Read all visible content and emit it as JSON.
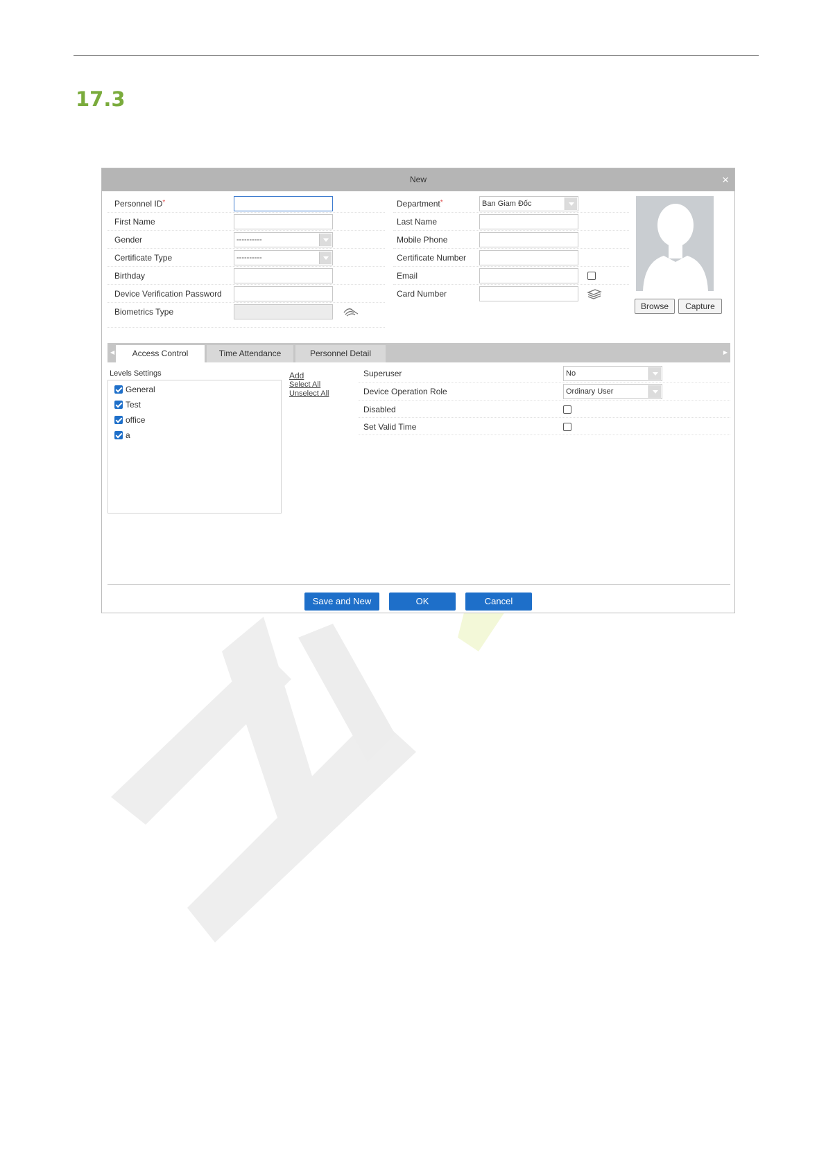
{
  "section": {
    "number": "17.3"
  },
  "dialog": {
    "title": "New",
    "close": "×",
    "fields": {
      "personnel_id": {
        "label": "Personnel ID",
        "required": "*",
        "value": ""
      },
      "first_name": {
        "label": "First Name",
        "value": ""
      },
      "gender": {
        "label": "Gender",
        "value": "----------"
      },
      "certificate_type": {
        "label": "Certificate Type",
        "value": "----------"
      },
      "birthday": {
        "label": "Birthday",
        "value": ""
      },
      "device_verification_password": {
        "label": "Device Verification Password",
        "value": ""
      },
      "biometrics_type": {
        "label": "Biometrics Type",
        "value": ""
      },
      "department": {
        "label": "Department",
        "required": "*",
        "value": "Ban Giam Đốc"
      },
      "last_name": {
        "label": "Last Name",
        "value": ""
      },
      "mobile_phone": {
        "label": "Mobile Phone",
        "value": ""
      },
      "certificate_number": {
        "label": "Certificate Number",
        "value": ""
      },
      "email": {
        "label": "Email",
        "value": ""
      },
      "card_number": {
        "label": "Card Number",
        "value": ""
      }
    },
    "photo_buttons": {
      "browse": "Browse",
      "capture": "Capture"
    },
    "tabs": [
      {
        "label": "Access Control",
        "active": true
      },
      {
        "label": "Time Attendance",
        "active": false
      },
      {
        "label": "Personnel Detail",
        "active": false
      }
    ],
    "levels": {
      "title": "Levels Settings",
      "items": [
        {
          "label": "General",
          "checked": true
        },
        {
          "label": "Test",
          "checked": true
        },
        {
          "label": "office",
          "checked": true
        },
        {
          "label": "a",
          "checked": true
        }
      ],
      "links": {
        "add": "Add",
        "select_all": "Select All",
        "unselect_all": "Unselect All"
      }
    },
    "access": {
      "superuser": {
        "label": "Superuser",
        "value": "No"
      },
      "device_operation_role": {
        "label": "Device Operation Role",
        "value": "Ordinary User"
      },
      "disabled": {
        "label": "Disabled",
        "checked": false
      },
      "set_valid_time": {
        "label": "Set Valid Time",
        "checked": false
      }
    },
    "footer": {
      "save_and_new": "Save and New",
      "ok": "OK",
      "cancel": "Cancel"
    }
  },
  "colors": {
    "accent": "#1e6fc9",
    "section_green": "#7aab3c",
    "titlebar": "#b5b5b5"
  }
}
